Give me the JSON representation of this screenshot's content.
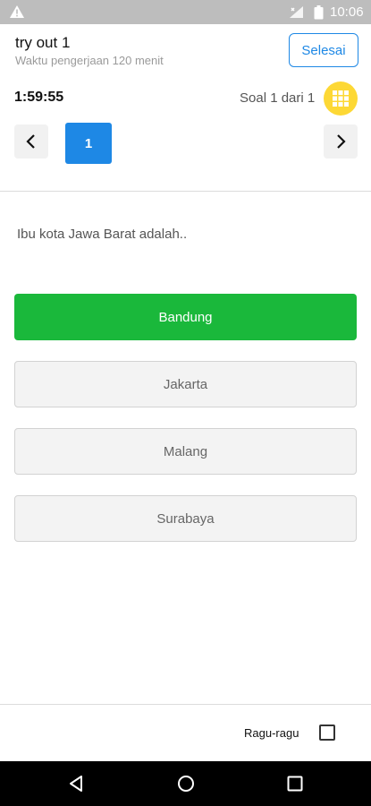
{
  "status_bar": {
    "time": "10:06"
  },
  "header": {
    "title": "try out 1",
    "subtitle": "Waktu pengerjaan 120 menit",
    "finish_label": "Selesai"
  },
  "quiz_info": {
    "timer": "1:59:55",
    "question_counter": "Soal 1 dari 1"
  },
  "navigation": {
    "current_question": "1"
  },
  "question": {
    "text": "Ibu kota Jawa Barat adalah.."
  },
  "options": [
    {
      "label": "Bandung",
      "selected": true
    },
    {
      "label": "Jakarta",
      "selected": false
    },
    {
      "label": "Malang",
      "selected": false
    },
    {
      "label": "Surabaya",
      "selected": false
    }
  ],
  "footer": {
    "doubt_label": "Ragu-ragu",
    "doubt_checked": false
  },
  "colors": {
    "accent": "#1e88e5",
    "selected": "#1ab83b",
    "grid_button": "#fdd835"
  }
}
